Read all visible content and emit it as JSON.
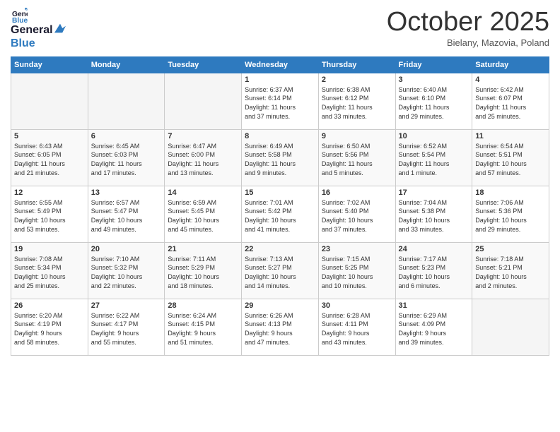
{
  "header": {
    "logo_line1": "General",
    "logo_line2": "Blue",
    "month": "October 2025",
    "location": "Bielany, Mazovia, Poland"
  },
  "weekdays": [
    "Sunday",
    "Monday",
    "Tuesday",
    "Wednesday",
    "Thursday",
    "Friday",
    "Saturday"
  ],
  "weeks": [
    [
      {
        "day": "",
        "info": ""
      },
      {
        "day": "",
        "info": ""
      },
      {
        "day": "",
        "info": ""
      },
      {
        "day": "1",
        "info": "Sunrise: 6:37 AM\nSunset: 6:14 PM\nDaylight: 11 hours\nand 37 minutes."
      },
      {
        "day": "2",
        "info": "Sunrise: 6:38 AM\nSunset: 6:12 PM\nDaylight: 11 hours\nand 33 minutes."
      },
      {
        "day": "3",
        "info": "Sunrise: 6:40 AM\nSunset: 6:10 PM\nDaylight: 11 hours\nand 29 minutes."
      },
      {
        "day": "4",
        "info": "Sunrise: 6:42 AM\nSunset: 6:07 PM\nDaylight: 11 hours\nand 25 minutes."
      }
    ],
    [
      {
        "day": "5",
        "info": "Sunrise: 6:43 AM\nSunset: 6:05 PM\nDaylight: 11 hours\nand 21 minutes."
      },
      {
        "day": "6",
        "info": "Sunrise: 6:45 AM\nSunset: 6:03 PM\nDaylight: 11 hours\nand 17 minutes."
      },
      {
        "day": "7",
        "info": "Sunrise: 6:47 AM\nSunset: 6:00 PM\nDaylight: 11 hours\nand 13 minutes."
      },
      {
        "day": "8",
        "info": "Sunrise: 6:49 AM\nSunset: 5:58 PM\nDaylight: 11 hours\nand 9 minutes."
      },
      {
        "day": "9",
        "info": "Sunrise: 6:50 AM\nSunset: 5:56 PM\nDaylight: 11 hours\nand 5 minutes."
      },
      {
        "day": "10",
        "info": "Sunrise: 6:52 AM\nSunset: 5:54 PM\nDaylight: 11 hours\nand 1 minute."
      },
      {
        "day": "11",
        "info": "Sunrise: 6:54 AM\nSunset: 5:51 PM\nDaylight: 10 hours\nand 57 minutes."
      }
    ],
    [
      {
        "day": "12",
        "info": "Sunrise: 6:55 AM\nSunset: 5:49 PM\nDaylight: 10 hours\nand 53 minutes."
      },
      {
        "day": "13",
        "info": "Sunrise: 6:57 AM\nSunset: 5:47 PM\nDaylight: 10 hours\nand 49 minutes."
      },
      {
        "day": "14",
        "info": "Sunrise: 6:59 AM\nSunset: 5:45 PM\nDaylight: 10 hours\nand 45 minutes."
      },
      {
        "day": "15",
        "info": "Sunrise: 7:01 AM\nSunset: 5:42 PM\nDaylight: 10 hours\nand 41 minutes."
      },
      {
        "day": "16",
        "info": "Sunrise: 7:02 AM\nSunset: 5:40 PM\nDaylight: 10 hours\nand 37 minutes."
      },
      {
        "day": "17",
        "info": "Sunrise: 7:04 AM\nSunset: 5:38 PM\nDaylight: 10 hours\nand 33 minutes."
      },
      {
        "day": "18",
        "info": "Sunrise: 7:06 AM\nSunset: 5:36 PM\nDaylight: 10 hours\nand 29 minutes."
      }
    ],
    [
      {
        "day": "19",
        "info": "Sunrise: 7:08 AM\nSunset: 5:34 PM\nDaylight: 10 hours\nand 25 minutes."
      },
      {
        "day": "20",
        "info": "Sunrise: 7:10 AM\nSunset: 5:32 PM\nDaylight: 10 hours\nand 22 minutes."
      },
      {
        "day": "21",
        "info": "Sunrise: 7:11 AM\nSunset: 5:29 PM\nDaylight: 10 hours\nand 18 minutes."
      },
      {
        "day": "22",
        "info": "Sunrise: 7:13 AM\nSunset: 5:27 PM\nDaylight: 10 hours\nand 14 minutes."
      },
      {
        "day": "23",
        "info": "Sunrise: 7:15 AM\nSunset: 5:25 PM\nDaylight: 10 hours\nand 10 minutes."
      },
      {
        "day": "24",
        "info": "Sunrise: 7:17 AM\nSunset: 5:23 PM\nDaylight: 10 hours\nand 6 minutes."
      },
      {
        "day": "25",
        "info": "Sunrise: 7:18 AM\nSunset: 5:21 PM\nDaylight: 10 hours\nand 2 minutes."
      }
    ],
    [
      {
        "day": "26",
        "info": "Sunrise: 6:20 AM\nSunset: 4:19 PM\nDaylight: 9 hours\nand 58 minutes."
      },
      {
        "day": "27",
        "info": "Sunrise: 6:22 AM\nSunset: 4:17 PM\nDaylight: 9 hours\nand 55 minutes."
      },
      {
        "day": "28",
        "info": "Sunrise: 6:24 AM\nSunset: 4:15 PM\nDaylight: 9 hours\nand 51 minutes."
      },
      {
        "day": "29",
        "info": "Sunrise: 6:26 AM\nSunset: 4:13 PM\nDaylight: 9 hours\nand 47 minutes."
      },
      {
        "day": "30",
        "info": "Sunrise: 6:28 AM\nSunset: 4:11 PM\nDaylight: 9 hours\nand 43 minutes."
      },
      {
        "day": "31",
        "info": "Sunrise: 6:29 AM\nSunset: 4:09 PM\nDaylight: 9 hours\nand 39 minutes."
      },
      {
        "day": "",
        "info": ""
      }
    ]
  ]
}
